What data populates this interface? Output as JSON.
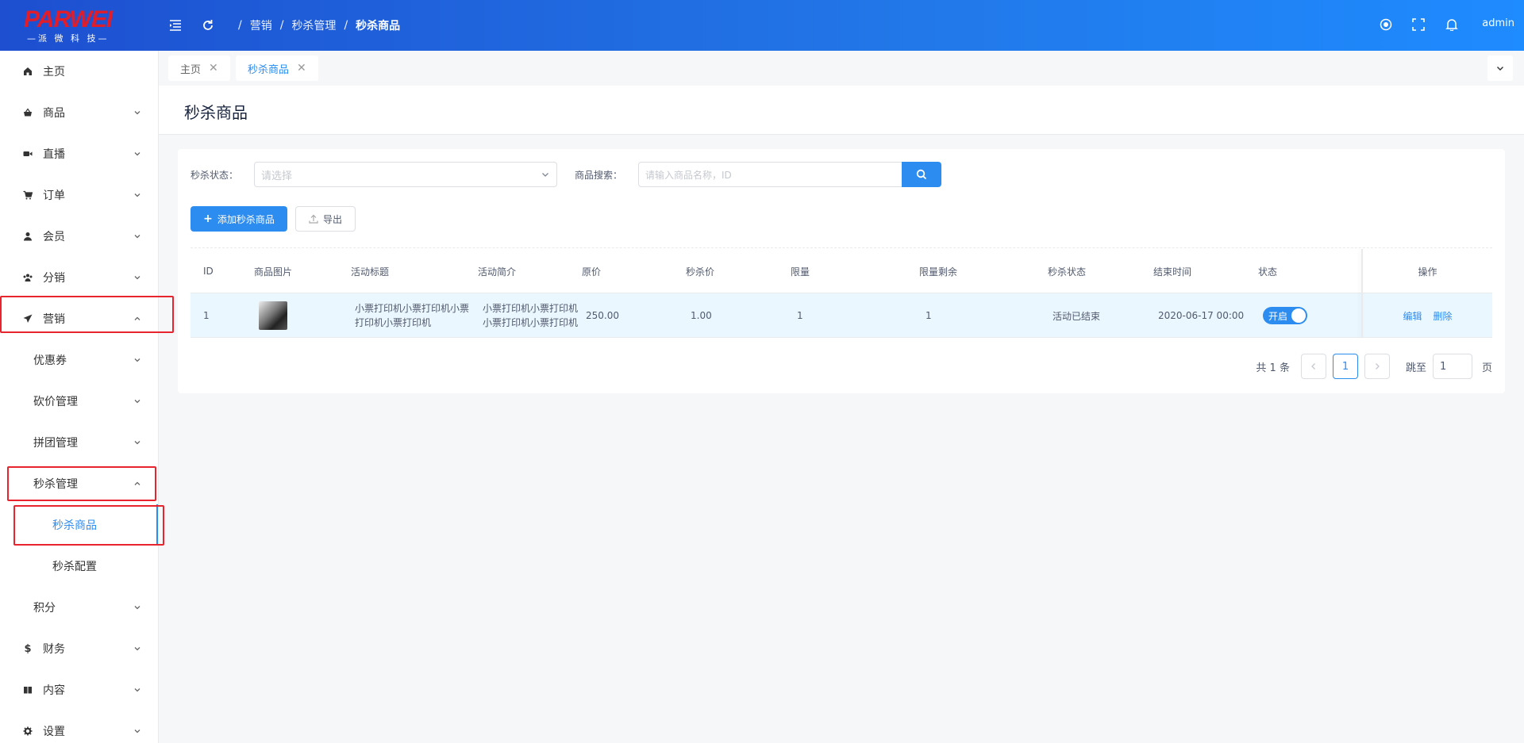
{
  "header": {
    "logo_brand_1": "PAR",
    "logo_brand_2": "WEI",
    "logo_sub": "—派 微 科 技—",
    "breadcrumb": [
      "营销",
      "秒杀管理",
      "秒杀商品"
    ],
    "user": "admin"
  },
  "sidebar": {
    "items": [
      {
        "label": "主页"
      },
      {
        "label": "商品"
      },
      {
        "label": "直播"
      },
      {
        "label": "订单"
      },
      {
        "label": "会员"
      },
      {
        "label": "分销"
      },
      {
        "label": "营销"
      },
      {
        "label": "优惠券"
      },
      {
        "label": "砍价管理"
      },
      {
        "label": "拼团管理"
      },
      {
        "label": "秒杀管理"
      },
      {
        "label": "秒杀商品"
      },
      {
        "label": "秒杀配置"
      },
      {
        "label": "积分"
      },
      {
        "label": "财务"
      },
      {
        "label": "内容"
      },
      {
        "label": "设置"
      }
    ]
  },
  "tabs": [
    {
      "label": "主页"
    },
    {
      "label": "秒杀商品"
    }
  ],
  "page": {
    "title": "秒杀商品"
  },
  "filters": {
    "status_label": "秒杀状态：",
    "status_placeholder": "请选择",
    "search_label": "商品搜索：",
    "search_placeholder": "请输入商品名称，ID"
  },
  "actions": {
    "add": "添加秒杀商品",
    "export": "导出"
  },
  "table": {
    "columns": [
      "ID",
      "商品图片",
      "活动标题",
      "活动简介",
      "原价",
      "秒杀价",
      "限量",
      "限量剩余",
      "秒杀状态",
      "结束时间",
      "状态",
      "操作"
    ],
    "rows": [
      {
        "id": "1",
        "title": "小票打印机小票打印机小票打印机小票打印机",
        "intro": "小票打印机小票打印机小票打印机小票打印机",
        "price": "250.00",
        "seckill_price": "1.00",
        "limit": "1",
        "limit_left": "1",
        "seckill_status": "活动已结束",
        "end_time": "2020-06-17 00:00",
        "switch_label": "开启",
        "edit": "编辑",
        "delete": "删除"
      }
    ]
  },
  "pagination": {
    "total": "共 1 条",
    "current_page": "1",
    "jump_label": "跳至",
    "jump_value": "1",
    "page_suffix": "页"
  },
  "colors": {
    "primary": "#2d8cf0",
    "header_start": "#1d4fd0",
    "header_end": "#1e8bff",
    "highlight_box": "#e8242e"
  }
}
